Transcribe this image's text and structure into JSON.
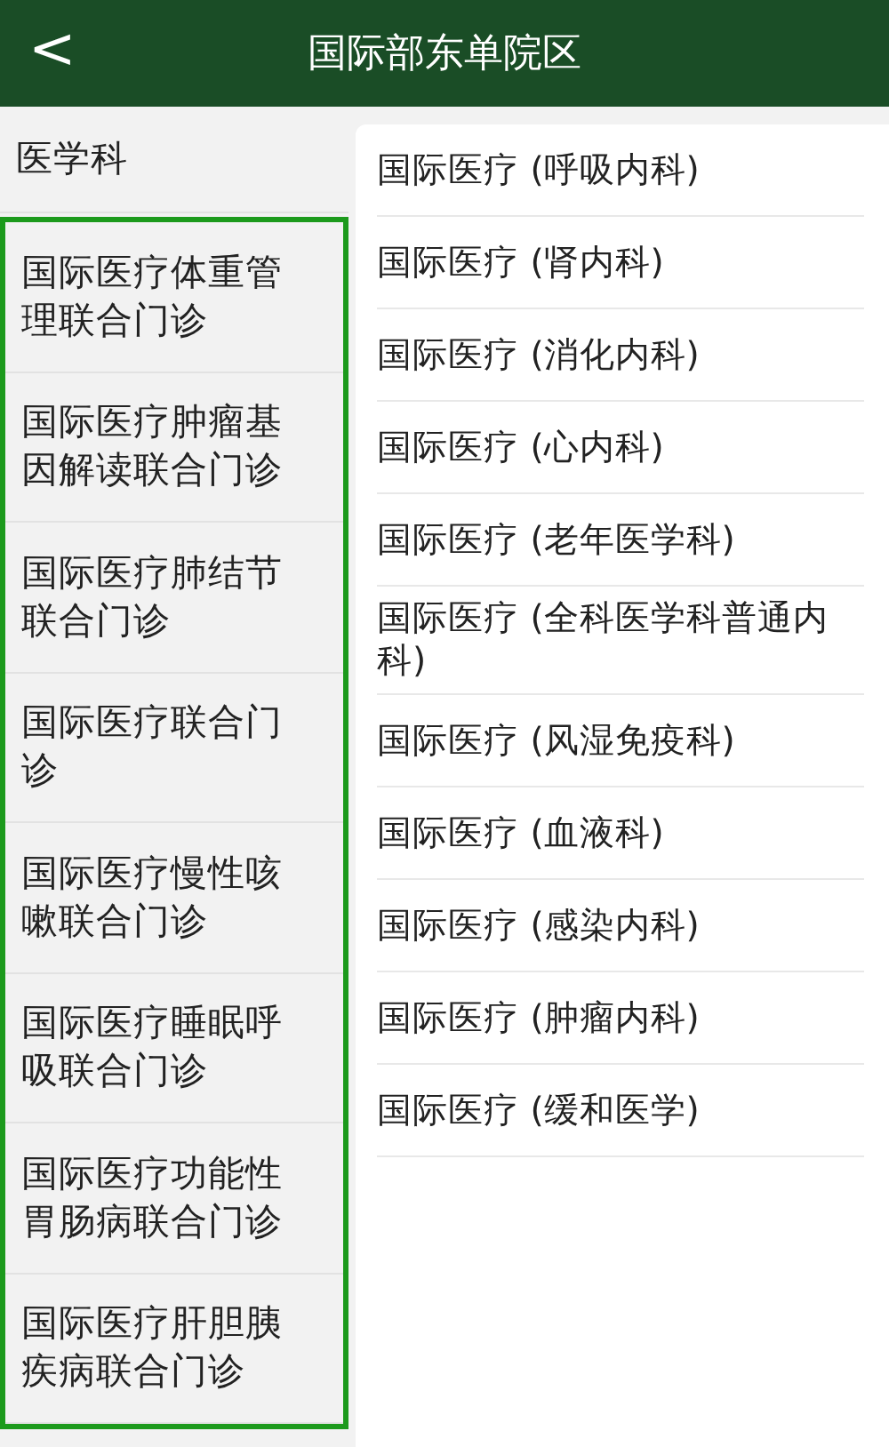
{
  "header": {
    "back": "<",
    "title": "国际部东单院区"
  },
  "sidebar": {
    "items": [
      {
        "label": "医学科",
        "highlighted": false
      },
      {
        "label": "国际医疗体重管理联合门诊",
        "highlighted": true
      },
      {
        "label": "国际医疗肿瘤基因解读联合门诊",
        "highlighted": true
      },
      {
        "label": "国际医疗肺结节联合门诊",
        "highlighted": true
      },
      {
        "label": "国际医疗联合门诊",
        "highlighted": true
      },
      {
        "label": "国际医疗慢性咳嗽联合门诊",
        "highlighted": true
      },
      {
        "label": "国际医疗睡眠呼吸联合门诊",
        "highlighted": true
      },
      {
        "label": "国际医疗功能性胃肠病联合门诊",
        "highlighted": true
      },
      {
        "label": "国际医疗肝胆胰疾病联合门诊",
        "highlighted": true
      }
    ]
  },
  "departments": [
    "国际医疗 (呼吸内科)",
    "国际医疗 (肾内科)",
    "国际医疗 (消化内科)",
    "国际医疗 (心内科)",
    "国际医疗 (老年医学科)",
    "国际医疗 (全科医学科普通内科)",
    "国际医疗 (风湿免疫科)",
    "国际医疗 (血液科)",
    "国际医疗 (感染内科)",
    "国际医疗 (肿瘤内科)",
    "国际医疗 (缓和医学)"
  ]
}
